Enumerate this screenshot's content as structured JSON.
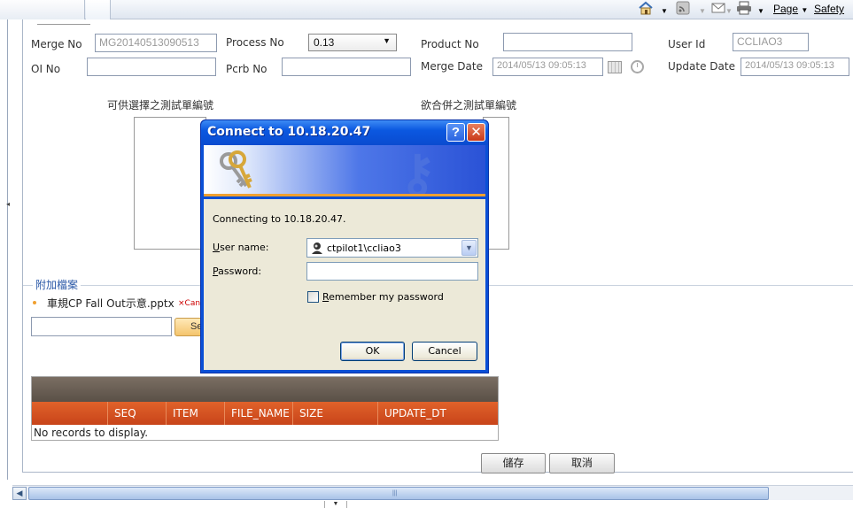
{
  "browser": {
    "toolbar": {
      "page_label": "Page",
      "safety_label": "Safety"
    }
  },
  "form": {
    "merge_no": {
      "label": "Merge No",
      "value": "MG20140513090513"
    },
    "process_no": {
      "label": "Process No",
      "value": "0.13"
    },
    "product_no": {
      "label": "Product No",
      "value": ""
    },
    "user_id": {
      "label": "User Id",
      "value": "CCLIAO3"
    },
    "oi_no": {
      "label": "OI No",
      "value": ""
    },
    "pcrb_no": {
      "label": "Pcrb No",
      "value": ""
    },
    "merge_date": {
      "label": "Merge Date",
      "value": "2014/05/13 09:05:13"
    },
    "update_date": {
      "label": "Update Date",
      "value": "2014/05/13 09:05:13"
    },
    "available_list_label": "可供選擇之測試單編號",
    "merge_list_label": "欲合併之測試單編號"
  },
  "attachments": {
    "title": "附加檔案",
    "file_name": "車規CP Fall Out示意.pptx",
    "cancel_label": "×Can",
    "upload_button": "Se"
  },
  "grid": {
    "columns": [
      "",
      "SEQ",
      "ITEM",
      "FILE_NAME",
      "SIZE",
      "UPDATE_DT"
    ],
    "empty_text": "No records to display."
  },
  "actions": {
    "save_label": "儲存",
    "cancel_label": "取消"
  },
  "dialog": {
    "title": "Connect to 10.18.20.47",
    "message": "Connecting to 10.18.20.47.",
    "username_label_u": "U",
    "username_label_rest": "ser name:",
    "username_value": "ctpilot1\\ccliao3",
    "password_label_u": "P",
    "password_label_rest": "assword:",
    "password_value": "",
    "remember_u": "R",
    "remember_rest": "emember my password",
    "remember_checked": false,
    "ok_label": "OK",
    "cancel_label": "Cancel",
    "help_glyph": "?",
    "close_glyph": "✕"
  }
}
